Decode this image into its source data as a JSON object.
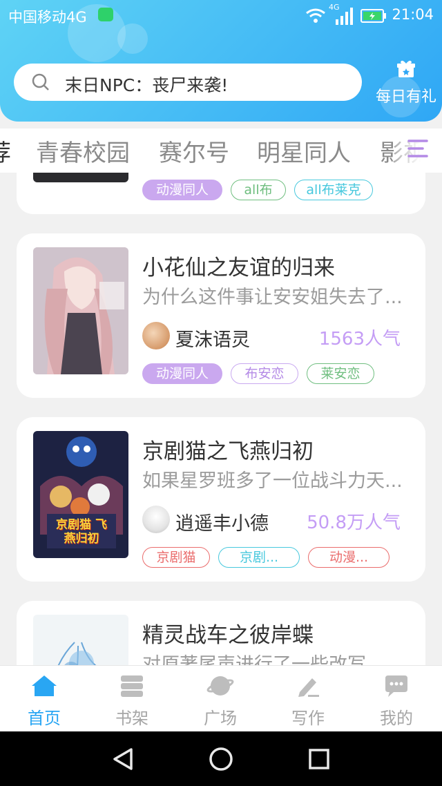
{
  "status_bar": {
    "carrier": "中国移动4G",
    "network": "4G",
    "time": "21:04"
  },
  "search": {
    "placeholder": "末日NPC：丧尸来袭!"
  },
  "daily_gift": {
    "label": "每日有礼"
  },
  "tabs": [
    {
      "label": "荐"
    },
    {
      "label": "青春校园"
    },
    {
      "label": "赛尔号"
    },
    {
      "label": "明星同人"
    },
    {
      "label": "影视"
    }
  ],
  "cards": [
    {
      "title": "",
      "tags": [
        "动漫同人",
        "all布",
        "all布莱克"
      ]
    },
    {
      "title": "小花仙之友谊的归来",
      "desc": "为什么这件事让安安姐失去了...",
      "author": "夏沫语灵",
      "popularity": "1563人气",
      "tags": [
        "动漫同人",
        "布安恋",
        "莱安恋"
      ]
    },
    {
      "title": "京剧猫之飞燕归初",
      "desc": "如果星罗班多了一位战斗力天...",
      "author": "逍遥丰小德",
      "popularity": "50.8万人气",
      "tags": [
        "京剧猫",
        "京剧...",
        "动漫..."
      ],
      "cover_text": "京剧猫 飞燕归初"
    },
    {
      "title": "精灵战车之彼岸蝶",
      "desc": "对原著尾声进行了一些改写，"
    }
  ],
  "bottom_nav": [
    {
      "label": "首页",
      "icon": "home-icon",
      "active": true
    },
    {
      "label": "书架",
      "icon": "bookshelf-icon",
      "active": false
    },
    {
      "label": "广场",
      "icon": "plaza-icon",
      "active": false
    },
    {
      "label": "写作",
      "icon": "pencil-icon",
      "active": false
    },
    {
      "label": "我的",
      "icon": "chat-bubble-icon",
      "active": false
    }
  ],
  "colors": {
    "accent": "#29a6f3",
    "popularity": "#c49df5",
    "tag_purple": "#caa8ef"
  }
}
